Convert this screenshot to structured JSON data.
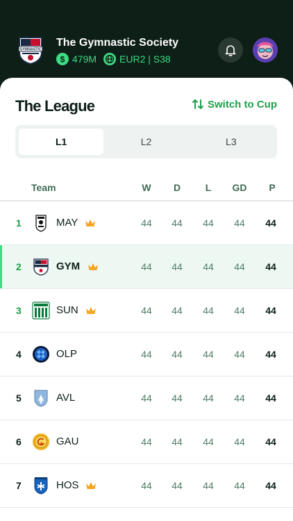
{
  "header": {
    "club_name": "The Gymnastic Society",
    "money": "479M",
    "league_code": "EUR2 | S38",
    "logo_text": "GYMNASTIC"
  },
  "league": {
    "title": "The League",
    "switch_label": "Switch to Cup",
    "tabs": [
      {
        "label": "L1",
        "active": true
      },
      {
        "label": "L2",
        "active": false
      },
      {
        "label": "L3",
        "active": false
      }
    ]
  },
  "table": {
    "headers": {
      "team": "Team",
      "w": "W",
      "d": "D",
      "l": "L",
      "gd": "GD",
      "p": "P"
    },
    "rows": [
      {
        "pos": "1",
        "team": "MAY",
        "crown": true,
        "w": "44",
        "d": "44",
        "l": "44",
        "gd": "44",
        "p": "44",
        "pos_color": "green",
        "highlight": false
      },
      {
        "pos": "2",
        "team": "GYM",
        "crown": true,
        "w": "44",
        "d": "44",
        "l": "44",
        "gd": "44",
        "p": "44",
        "pos_color": "green",
        "highlight": true
      },
      {
        "pos": "3",
        "team": "SUN",
        "crown": true,
        "w": "44",
        "d": "44",
        "l": "44",
        "gd": "44",
        "p": "44",
        "pos_color": "green",
        "highlight": false
      },
      {
        "pos": "4",
        "team": "OLP",
        "crown": false,
        "w": "44",
        "d": "44",
        "l": "44",
        "gd": "44",
        "p": "44",
        "pos_color": "dark",
        "highlight": false
      },
      {
        "pos": "5",
        "team": "AVL",
        "crown": false,
        "w": "44",
        "d": "44",
        "l": "44",
        "gd": "44",
        "p": "44",
        "pos_color": "dark",
        "highlight": false
      },
      {
        "pos": "6",
        "team": "GAU",
        "crown": false,
        "w": "44",
        "d": "44",
        "l": "44",
        "gd": "44",
        "p": "44",
        "pos_color": "dark",
        "highlight": false
      },
      {
        "pos": "7",
        "team": "HOS",
        "crown": true,
        "w": "44",
        "d": "44",
        "l": "44",
        "gd": "44",
        "p": "44",
        "pos_color": "dark",
        "highlight": false
      }
    ]
  },
  "colors": {
    "accent": "#3ddc84",
    "accent_dark": "#1fa04a",
    "header_bg": "#0d1f17",
    "crown": "#f5a623"
  },
  "icons": {
    "bell": "bell-icon",
    "dollar": "dollar-icon",
    "globe": "globe-icon",
    "swap": "swap-arrows-icon",
    "crown": "crown-icon"
  }
}
